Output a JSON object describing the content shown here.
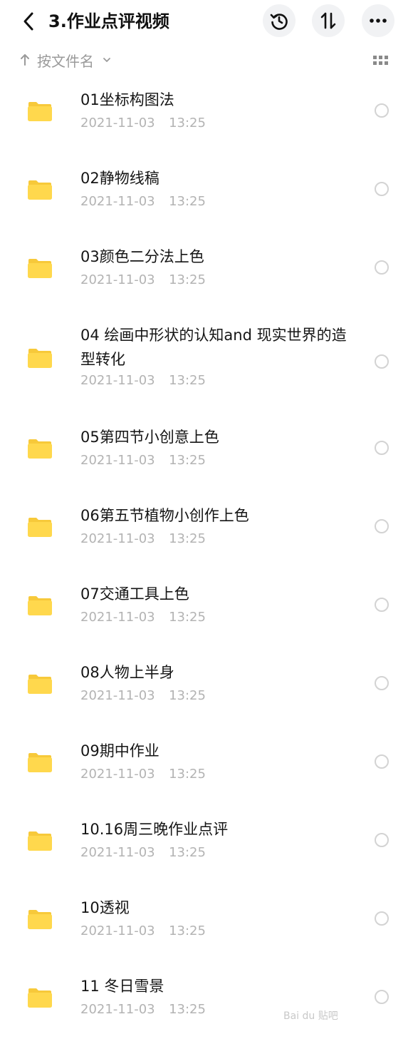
{
  "header": {
    "title": "3.作业点评视频",
    "back_icon": "chevron-left-icon",
    "actions": [
      "history-icon",
      "sort-updown-icon",
      "more-icon"
    ]
  },
  "sortbar": {
    "label": "按文件名",
    "view_icon": "grid-view-icon"
  },
  "items": [
    {
      "name": "01坐标构图法",
      "date": "2021-11-03",
      "time": "13:25"
    },
    {
      "name": "02静物线稿",
      "date": "2021-11-03",
      "time": "13:25"
    },
    {
      "name": "03颜色二分法上色",
      "date": "2021-11-03",
      "time": "13:25"
    },
    {
      "name": "04 绘画中形状的认知and 现实世界的造型转化",
      "date": "2021-11-03",
      "time": "13:25"
    },
    {
      "name": "05第四节小创意上色",
      "date": "2021-11-03",
      "time": "13:25"
    },
    {
      "name": "06第五节植物小创作上色",
      "date": "2021-11-03",
      "time": "13:25"
    },
    {
      "name": "07交通工具上色",
      "date": "2021-11-03",
      "time": "13:25"
    },
    {
      "name": "08人物上半身",
      "date": "2021-11-03",
      "time": "13:25"
    },
    {
      "name": "09期中作业",
      "date": "2021-11-03",
      "time": "13:25"
    },
    {
      "name": "10.16周三晚作业点评",
      "date": "2021-11-03",
      "time": "13:25"
    },
    {
      "name": "10透视",
      "date": "2021-11-03",
      "time": "13:25"
    },
    {
      "name": "11 冬日雪景",
      "date": "2021-11-03",
      "time": "13:25"
    }
  ],
  "colors": {
    "folder": "#ffd84d",
    "folder_tab": "#f7c93a",
    "meta_text": "#b3b3b3",
    "button_bg": "#f1f2f4"
  },
  "watermark": "Bai du 贴吧"
}
